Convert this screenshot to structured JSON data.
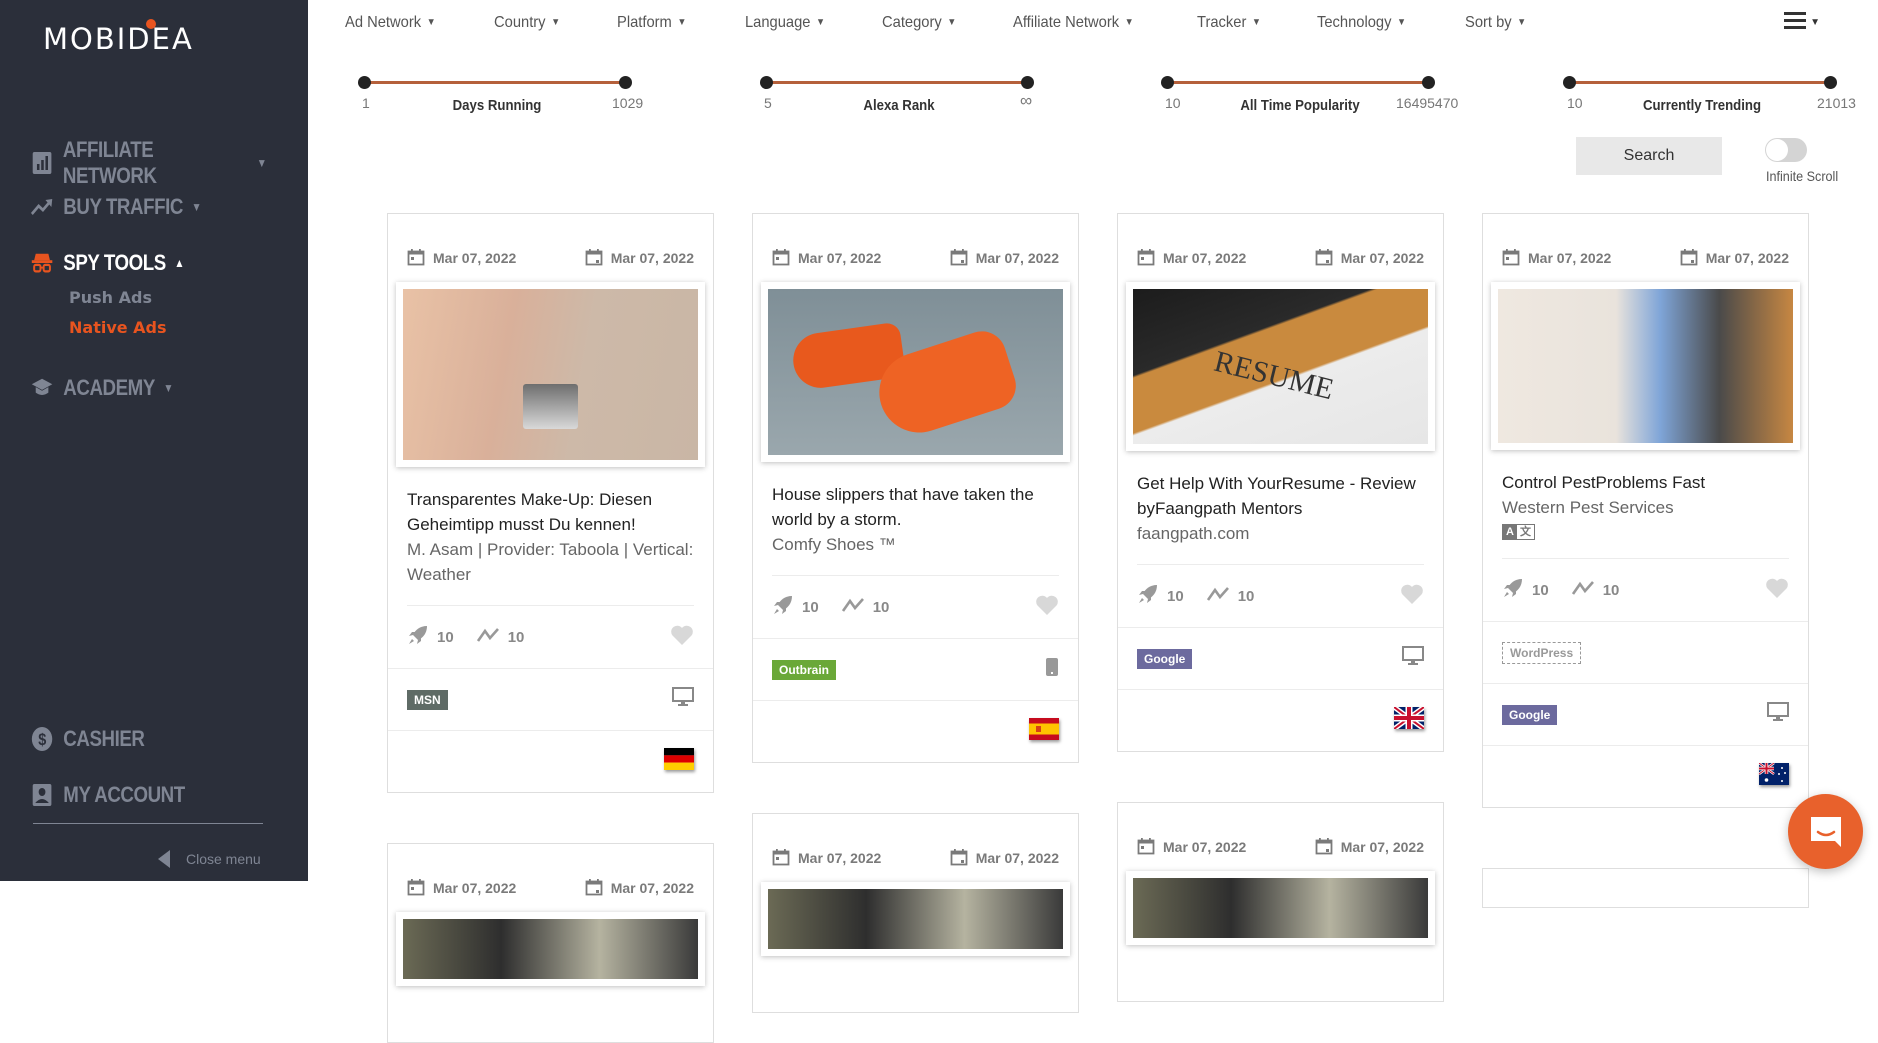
{
  "brand": {
    "logo_text": "MOBIDEA",
    "accent": "#e8541f"
  },
  "sidebar": {
    "items": [
      {
        "label": "AFFILIATE NETWORK",
        "icon": "bar-chart-icon",
        "expanded": false
      },
      {
        "label": "BUY TRAFFIC",
        "icon": "trending-up-icon",
        "expanded": false
      },
      {
        "label": "SPY TOOLS",
        "icon": "spy-icon",
        "expanded": true,
        "active": true,
        "children": [
          {
            "label": "Push Ads",
            "active": false
          },
          {
            "label": "Native Ads",
            "active": true
          }
        ]
      },
      {
        "label": "ACADEMY",
        "icon": "graduation-cap-icon",
        "expanded": false
      }
    ],
    "bottom_items": [
      {
        "label": "CASHIER",
        "icon": "dollar-circle-icon"
      },
      {
        "label": "MY ACCOUNT",
        "icon": "account-box-icon"
      }
    ],
    "close_menu": "Close menu"
  },
  "filters": [
    "Ad Network",
    "Country",
    "Platform",
    "Language",
    "Category",
    "Affiliate Network",
    "Tracker",
    "Technology",
    "Sort by"
  ],
  "sliders": [
    {
      "label": "Days Running",
      "min": "1",
      "max": "1029"
    },
    {
      "label": "Alexa Rank",
      "min": "5",
      "max": "∞"
    },
    {
      "label": "All Time Popularity",
      "min": "10",
      "max": "16495470"
    },
    {
      "label": "Currently Trending",
      "min": "10",
      "max": "21013"
    }
  ],
  "search_label": "Search",
  "infinite_scroll": {
    "label": "Infinite Scroll",
    "enabled": false
  },
  "cards": [
    {
      "first_seen": "Mar 07, 2022",
      "last_seen": "Mar 07, 2022",
      "title": "Transparentes Make-Up: Diesen Geheimtipp musst Du kennen!",
      "subtitle": "M. Asam | Provider: Taboola | Vertical: Weather",
      "days": "10",
      "trend": "10",
      "network": "MSN",
      "network_color": "#5f6b66",
      "device": "desktop",
      "country": "Germany"
    },
    {
      "first_seen": "Mar 07, 2022",
      "last_seen": "Mar 07, 2022",
      "title": "House slippers that have taken the world by a storm.",
      "subtitle": "Comfy Shoes ™",
      "days": "10",
      "trend": "10",
      "network": "Outbrain",
      "network_color": "#6aa838",
      "device": "mobile",
      "country": "Spain"
    },
    {
      "first_seen": "Mar 07, 2022",
      "last_seen": "Mar 07, 2022",
      "title": "Get Help With YourResume - Review byFaangpath Mentors",
      "subtitle": "faangpath.com",
      "days": "10",
      "trend": "10",
      "network": "Google",
      "network_color": "#6c6a9e",
      "device": "desktop",
      "country": "United Kingdom"
    },
    {
      "first_seen": "Mar 07, 2022",
      "last_seen": "Mar 07, 2022",
      "title": "Control PestProblems Fast",
      "subtitle": "Western Pest Services",
      "language_badge": true,
      "days": "10",
      "trend": "10",
      "technology": "WordPress",
      "network": "Google",
      "network_color": "#6c6a9e",
      "device": "desktop",
      "country": "Australia"
    }
  ],
  "next_cards": [
    {
      "first_seen": "Mar 07, 2022",
      "last_seen": "Mar 07, 2022"
    },
    {
      "first_seen": "Mar 07, 2022",
      "last_seen": "Mar 07, 2022"
    },
    {
      "first_seen": "Mar 07, 2022",
      "last_seen": "Mar 07, 2022"
    }
  ]
}
